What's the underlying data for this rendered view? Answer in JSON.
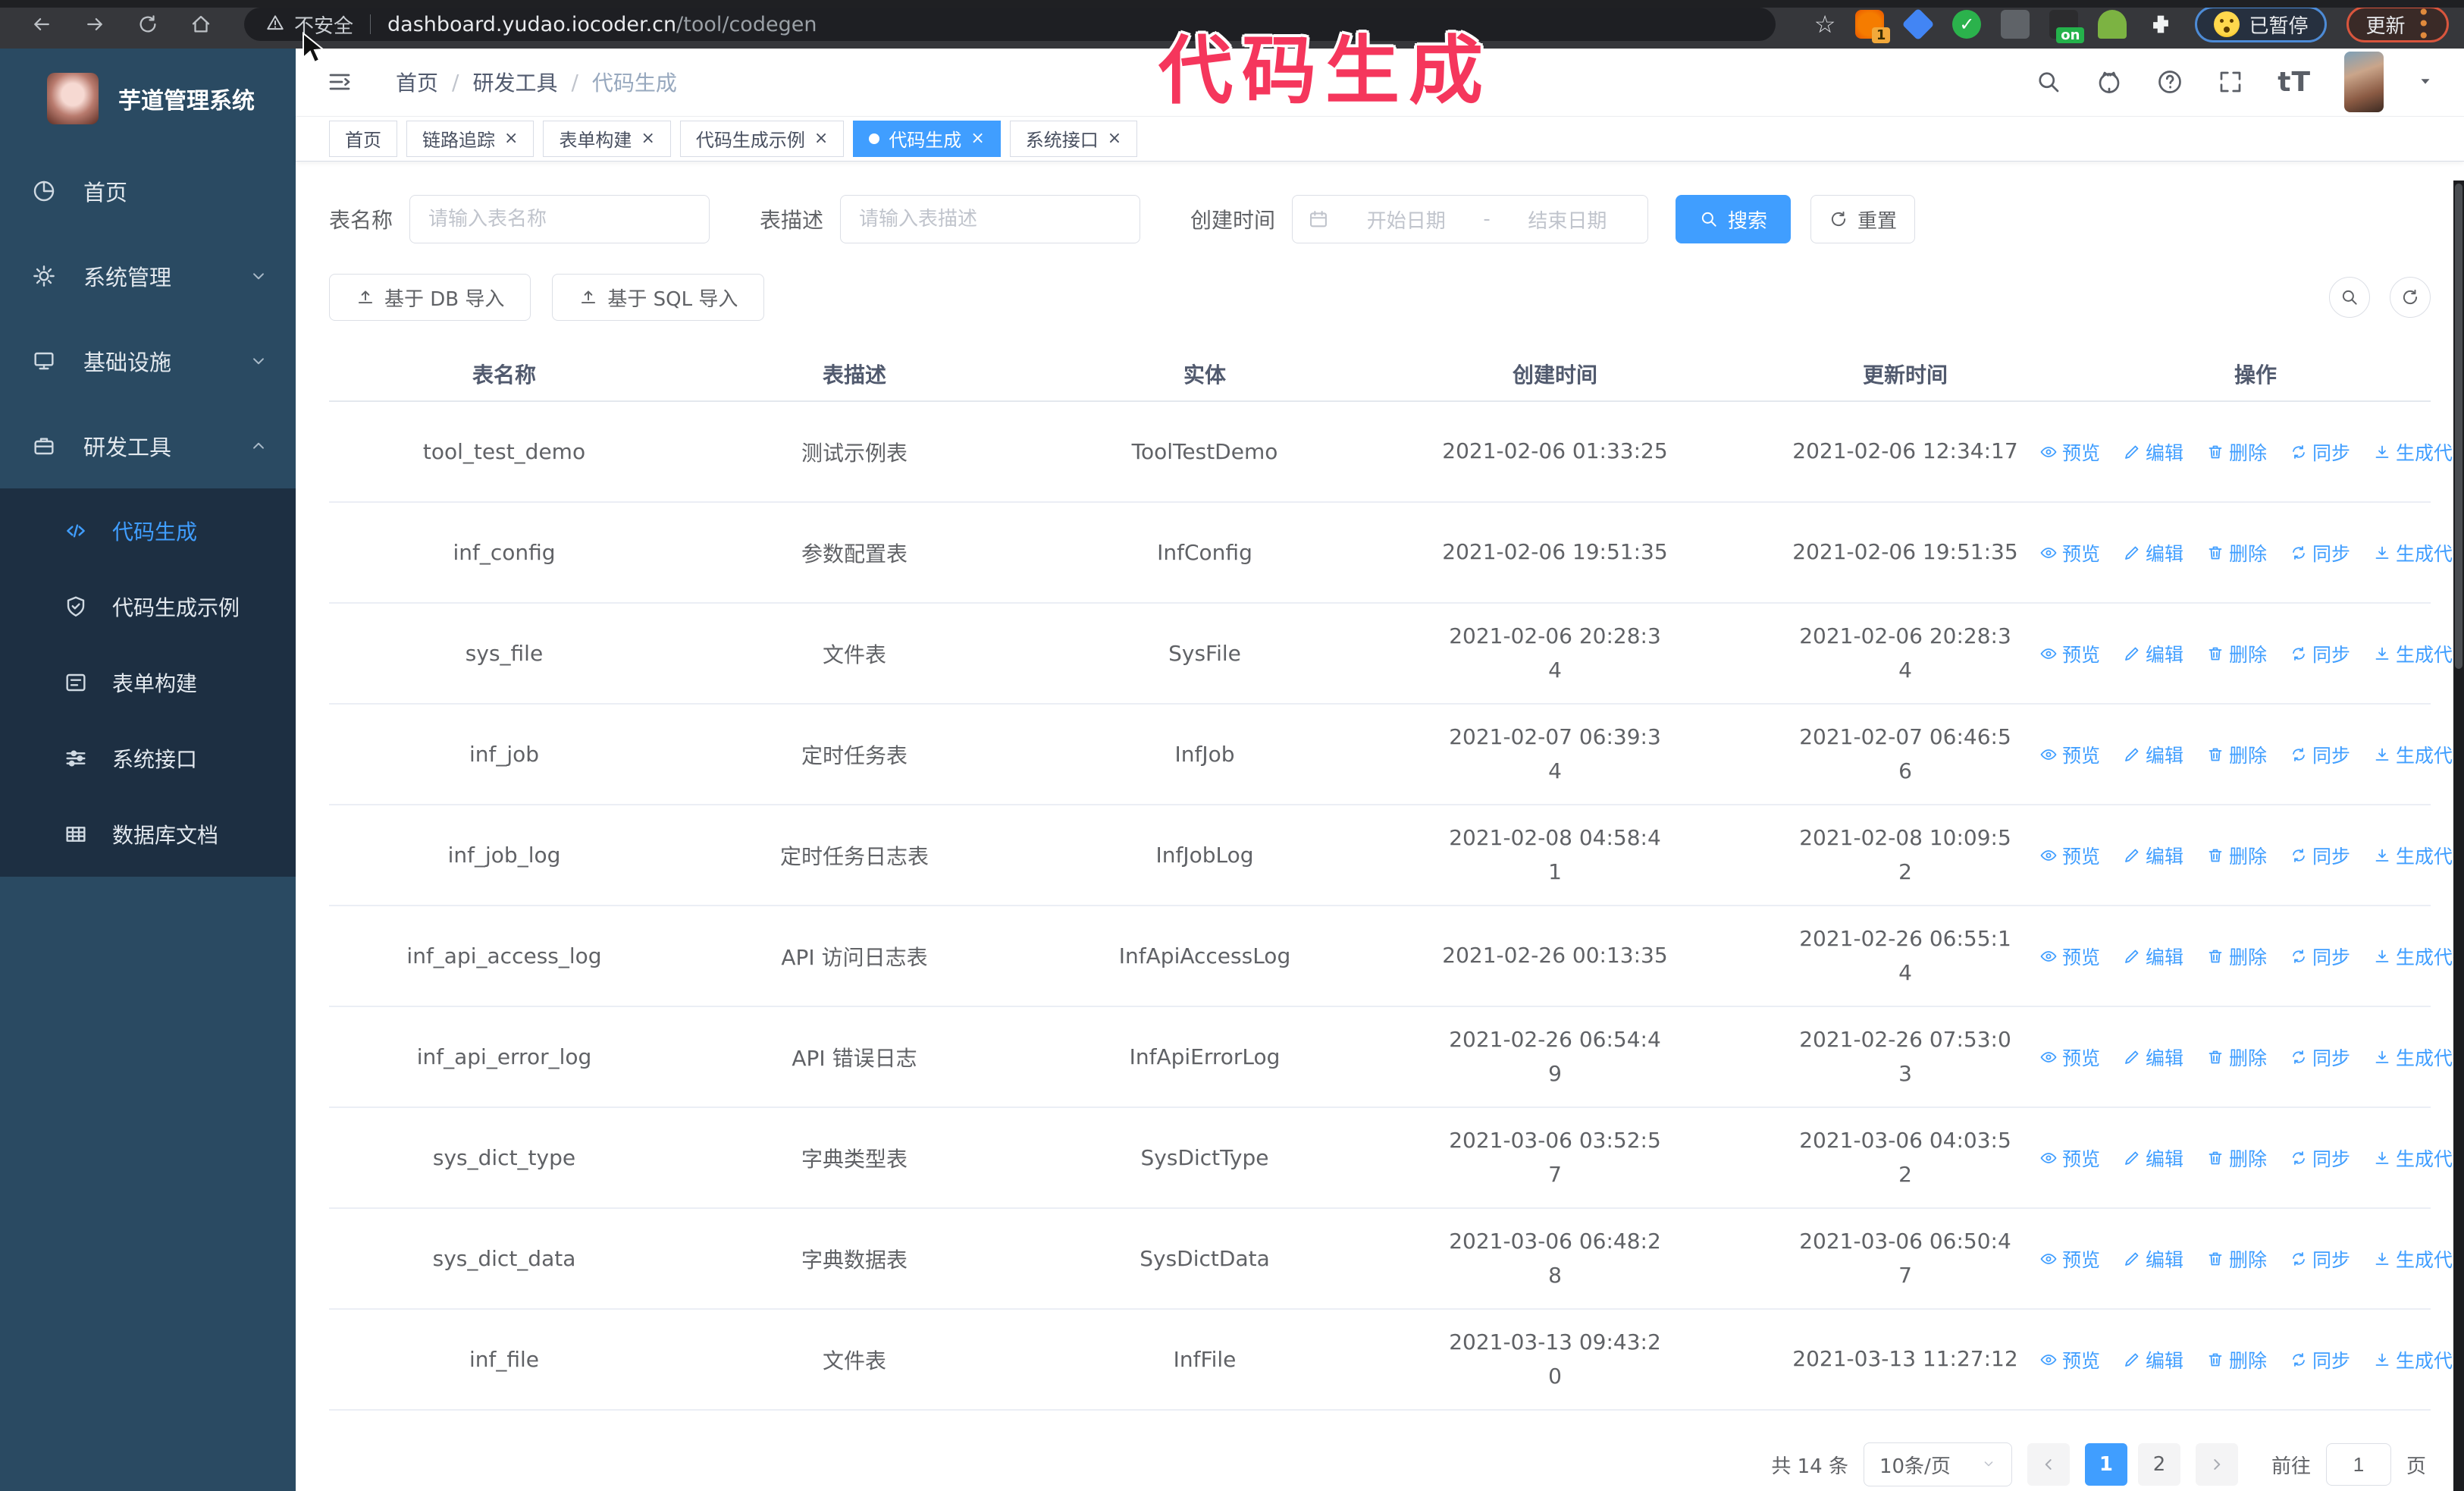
{
  "annotation": {
    "text": "代码生成",
    "color": "#f5365c"
  },
  "browser": {
    "security_label": "不安全",
    "url_host": "dashboard.yudao.iocoder.cn",
    "url_path": "/tool/codegen",
    "star_icon": "☆",
    "extension_badge_count": "1",
    "extension_on_badge": "on",
    "paused_badge": "已暂停",
    "update_button": "更新"
  },
  "sidebar": {
    "title": "芋道管理系统",
    "menu": [
      {
        "icon": "pie-icon",
        "label": "首页"
      },
      {
        "icon": "gear-icon",
        "label": "系统管理",
        "chevron_icon": "chevron-down-icon"
      },
      {
        "icon": "monitor-icon",
        "label": "基础设施",
        "chevron_icon": "chevron-down-icon"
      },
      {
        "icon": "briefcase-icon",
        "label": "研发工具",
        "chevron_icon": "chevron-up-icon",
        "open": true
      }
    ],
    "submenu": [
      {
        "icon": "code-icon",
        "label": "代码生成",
        "active": true
      },
      {
        "icon": "shield-check-icon",
        "label": "代码生成示例"
      },
      {
        "icon": "form-icon",
        "label": "表单构建"
      },
      {
        "icon": "sliders-icon",
        "label": "系统接口"
      },
      {
        "icon": "table-grid-icon",
        "label": "数据库文档"
      }
    ]
  },
  "header": {
    "breadcrumb": [
      {
        "label": "首页",
        "sep": "/"
      },
      {
        "label": "研发工具",
        "sep": "/"
      },
      {
        "label": "代码生成",
        "last": true
      }
    ]
  },
  "tabs": [
    {
      "label": "首页"
    },
    {
      "label": "链路追踪",
      "closable": true
    },
    {
      "label": "表单构建",
      "closable": true
    },
    {
      "label": "代码生成示例",
      "closable": true
    },
    {
      "label": "代码生成",
      "closable": true,
      "active": true
    },
    {
      "label": "系统接口",
      "closable": true
    }
  ],
  "search": {
    "name_label": "表名称",
    "name_placeholder": "请输入表名称",
    "desc_label": "表描述",
    "desc_placeholder": "请输入表描述",
    "time_label": "创建时间",
    "start_placeholder": "开始日期",
    "range_separator": "-",
    "end_placeholder": "结束日期",
    "search_button": "搜索",
    "reset_button": "重置"
  },
  "toolbar": {
    "import_db_button": "基于 DB 导入",
    "import_sql_button": "基于 SQL 导入"
  },
  "table": {
    "columns": [
      {
        "label": "表名称"
      },
      {
        "label": "表描述"
      },
      {
        "label": "实体"
      },
      {
        "label": "创建时间"
      },
      {
        "label": "更新时间"
      },
      {
        "label": "操作"
      }
    ],
    "actions": [
      {
        "icon": "eye-icon",
        "label": "预览"
      },
      {
        "icon": "edit-icon",
        "label": "编辑"
      },
      {
        "icon": "delete-icon",
        "label": "删除"
      },
      {
        "icon": "sync-icon",
        "label": "同步"
      },
      {
        "icon": "generate-icon",
        "label": "生成代码"
      }
    ],
    "rows": [
      {
        "name": "tool_test_demo",
        "desc": "测试示例表",
        "entity": "ToolTestDemo",
        "created": "2021-02-06 01:33:25",
        "updated": "2021-02-06 12:34:17"
      },
      {
        "name": "inf_config",
        "desc": "参数配置表",
        "entity": "InfConfig",
        "created": "2021-02-06 19:51:35",
        "updated": "2021-02-06 19:51:35"
      },
      {
        "name": "sys_file",
        "desc": "文件表",
        "entity": "SysFile",
        "created": "2021-02-06 20:28:3\n4",
        "updated": "2021-02-06 20:28:3\n4"
      },
      {
        "name": "inf_job",
        "desc": "定时任务表",
        "entity": "InfJob",
        "created": "2021-02-07 06:39:3\n4",
        "updated": "2021-02-07 06:46:5\n6"
      },
      {
        "name": "inf_job_log",
        "desc": "定时任务日志表",
        "entity": "InfJobLog",
        "created": "2021-02-08 04:58:4\n1",
        "updated": "2021-02-08 10:09:5\n2"
      },
      {
        "name": "inf_api_access_log",
        "desc": "API 访问日志表",
        "entity": "InfApiAccessLog",
        "created": "2021-02-26 00:13:35",
        "updated": "2021-02-26 06:55:1\n4"
      },
      {
        "name": "inf_api_error_log",
        "desc": "API 错误日志",
        "entity": "InfApiErrorLog",
        "created": "2021-02-26 06:54:4\n9",
        "updated": "2021-02-26 07:53:0\n3"
      },
      {
        "name": "sys_dict_type",
        "desc": "字典类型表",
        "entity": "SysDictType",
        "created": "2021-03-06 03:52:5\n7",
        "updated": "2021-03-06 04:03:5\n2"
      },
      {
        "name": "sys_dict_data",
        "desc": "字典数据表",
        "entity": "SysDictData",
        "created": "2021-03-06 06:48:2\n8",
        "updated": "2021-03-06 06:50:4\n7"
      },
      {
        "name": "inf_file",
        "desc": "文件表",
        "entity": "InfFile",
        "created": "2021-03-13 09:43:2\n0",
        "updated": "2021-03-13 11:27:12"
      }
    ]
  },
  "pagination": {
    "total": "共 14 条",
    "page_size": "10条/页",
    "pages": [
      {
        "num": "1",
        "active": true
      },
      {
        "num": "2"
      }
    ],
    "goto_label": "前往",
    "goto_value": "1",
    "goto_unit": "页"
  },
  "colors": {
    "accent": "#409EFF",
    "sidebar": "#2a4a62",
    "submenu": "#1d2f42",
    "annotation": "#f5365c"
  }
}
